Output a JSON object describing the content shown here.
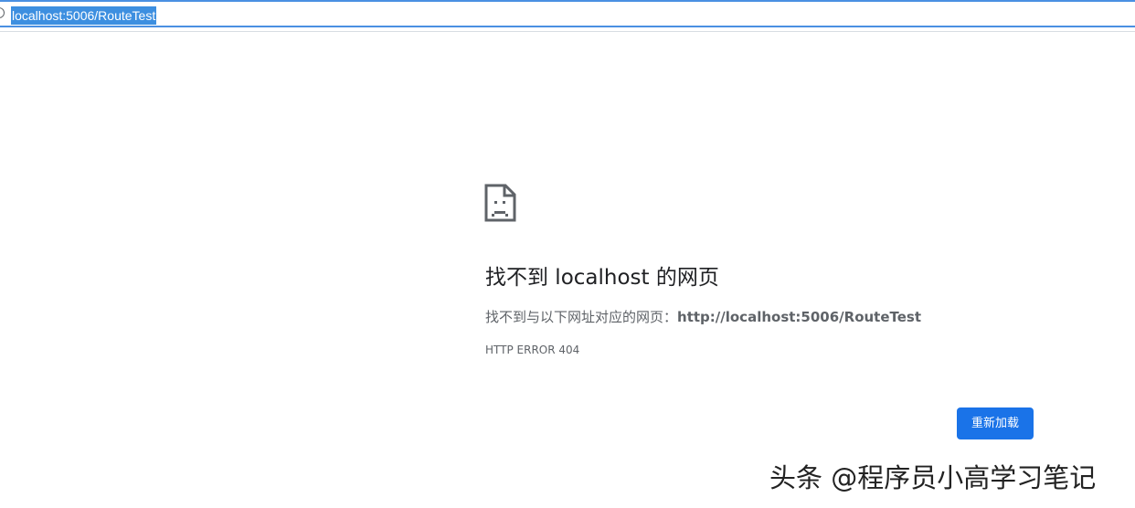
{
  "address_bar": {
    "url": "localhost:5006/RouteTest",
    "info_icon": "info-circle-icon"
  },
  "error_page": {
    "icon": "sad-page-icon",
    "title": "找不到 localhost 的网页",
    "description_prefix": "找不到与以下网址对应的网页：",
    "description_url": "http://localhost:5006/RouteTest",
    "error_code": "HTTP ERROR 404",
    "reload_label": "重新加载",
    "accent_color": "#1a73e8"
  },
  "watermark": {
    "text": "头条 @程序员小高学习笔记"
  }
}
